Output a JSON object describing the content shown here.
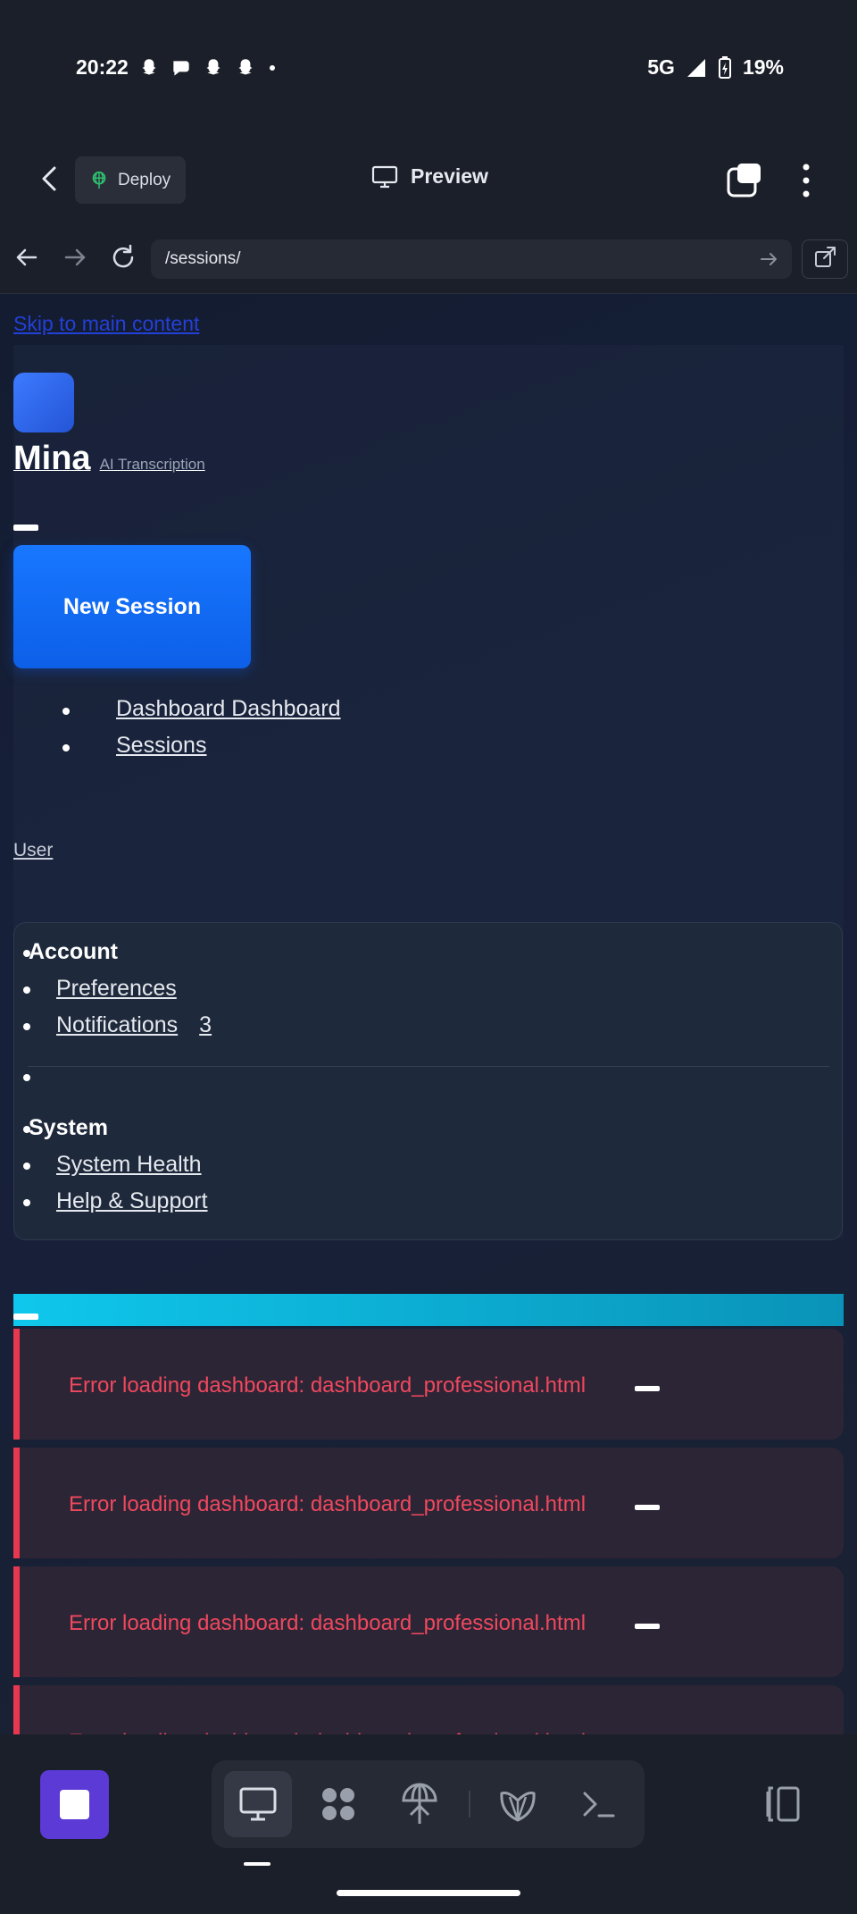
{
  "status_bar": {
    "time": "20:22",
    "network": "5G",
    "battery": "19%"
  },
  "header": {
    "deploy_label": "Deploy",
    "preview_label": "Preview"
  },
  "url_bar": {
    "url": "/sessions/"
  },
  "page": {
    "skip_link": "Skip to main content",
    "brand_name": "Mina",
    "brand_subtitle": "AI Transcription",
    "new_session_label": "New Session",
    "nav_items": [
      {
        "label": "Dashboard Dashboard"
      },
      {
        "label": "Sessions"
      }
    ],
    "user_link": "User",
    "menu": {
      "account_heading": "Account",
      "preferences": "Preferences",
      "notifications": "Notifications",
      "notifications_count": "3",
      "system_heading": "System",
      "system_health": "System Health",
      "help_support": "Help & Support"
    },
    "error_message": "Error loading dashboard: dashboard_professional.html"
  },
  "colors": {
    "accent_blue": "#1877ff",
    "error_red": "#f0485e",
    "cyan": "#0fc7ec",
    "stop_purple": "#5b3ad6"
  },
  "bottom_bar": {
    "tools": [
      "monitor-icon",
      "grid-icon",
      "deploy-icon",
      "shell-icon",
      "terminal-icon"
    ]
  }
}
